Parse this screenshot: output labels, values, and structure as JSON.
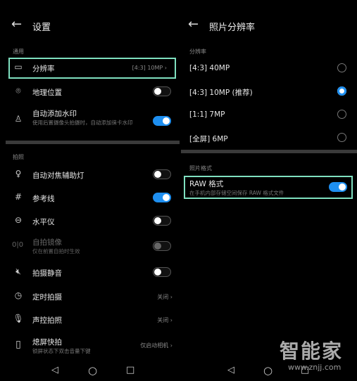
{
  "left": {
    "title": "设置",
    "sections": [
      {
        "label": "通用"
      },
      {
        "label": "拍照"
      }
    ],
    "items": [
      {
        "label": "分辨率",
        "value": "[4:3] 10MP",
        "icon": "aspect-ratio-icon"
      },
      {
        "label": "地理位置",
        "toggle": false,
        "icon": "location-pin-icon"
      },
      {
        "label": "自动添加水印",
        "sub": "使用后置摄像头拍摄时，自动添加徕卡水印",
        "toggle": true,
        "icon": "stamp-icon"
      },
      {
        "label": "自动对焦辅助灯",
        "toggle": false,
        "icon": "bulb-icon"
      },
      {
        "label": "参考线",
        "toggle": true,
        "icon": "grid-icon"
      },
      {
        "label": "水平仪",
        "toggle": false,
        "icon": "level-icon"
      },
      {
        "label": "自拍镜像",
        "sub": "仅在前置自拍时生效",
        "toggle": false,
        "disabled": true,
        "icon": "mirror-icon",
        "icon_text": "0|0"
      },
      {
        "label": "拍摄静音",
        "toggle": false,
        "icon": "mute-icon"
      },
      {
        "label": "定时拍摄",
        "value": "关闭",
        "icon": "timer-icon"
      },
      {
        "label": "声控拍照",
        "value": "关闭",
        "icon": "microphone-icon"
      },
      {
        "label": "熄屏快拍",
        "sub": "锁屏状态下双击音量下键",
        "value": "仅启动相机",
        "icon": "phone-side-icon"
      }
    ]
  },
  "right": {
    "title": "照片分辨率",
    "section_resolution": "分辨率",
    "options": [
      {
        "label": "[4:3] 40MP",
        "selected": false
      },
      {
        "label": "[4:3] 10MP (推荐)",
        "selected": true
      },
      {
        "label": "[1:1] 7MP",
        "selected": false
      },
      {
        "label": "[全屏] 6MP",
        "selected": false
      }
    ],
    "section_format": "照片格式",
    "raw": {
      "label": "RAW 格式",
      "sub": "在手机内部存储空间保存 RAW 格式文件",
      "toggle": true
    }
  },
  "watermark": {
    "brand": "智能家",
    "url": "www.znjj.com"
  },
  "colors": {
    "accent": "#1e8ff0",
    "highlight": "#7fe0c0"
  }
}
